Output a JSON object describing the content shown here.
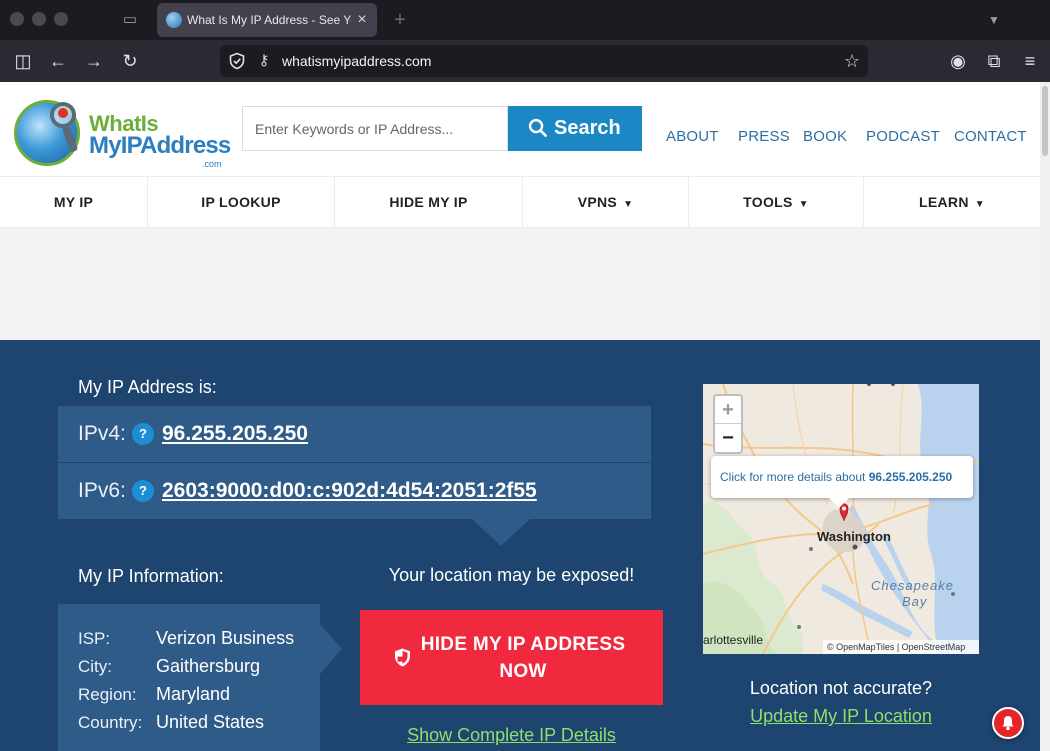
{
  "browser": {
    "tab_title": "What Is My IP Address - See Your Public Address",
    "tab_close": "×",
    "new_tab": "+",
    "url": "whatismyipaddress.com"
  },
  "site": {
    "logo": {
      "line1": "WhatIs",
      "line2": "MyIPAddress",
      "line3": ".com"
    },
    "search": {
      "placeholder": "Enter Keywords or IP Address...",
      "button": "Search"
    },
    "top_links": [
      "ABOUT",
      "PRESS",
      "BOOK",
      "PODCAST",
      "CONTACT"
    ],
    "nav": [
      {
        "label": "MY IP",
        "caret": ""
      },
      {
        "label": "IP LOOKUP",
        "caret": ""
      },
      {
        "label": "HIDE MY IP",
        "caret": ""
      },
      {
        "label": "VPNS",
        "caret": "▼"
      },
      {
        "label": "TOOLS",
        "caret": "▼"
      },
      {
        "label": "LEARN",
        "caret": "▼"
      }
    ]
  },
  "hero": {
    "ip_heading": "My IP Address is:",
    "ipv4": {
      "label": "IPv4:",
      "help": "?",
      "value": "96.255.205.250"
    },
    "ipv6": {
      "label": "IPv6:",
      "help": "?",
      "value": "2603:9000:d00:c:902d:4d54:2051:2f55"
    },
    "info_heading": "My IP Information:",
    "info": [
      {
        "label": "ISP:",
        "value": "Verizon Business"
      },
      {
        "label": "City:",
        "value": "Gaithersburg"
      },
      {
        "label": "Region:",
        "value": "Maryland"
      },
      {
        "label": "Country:",
        "value": "United States"
      }
    ],
    "exposed_text": "Your location may be exposed!",
    "hide_button_line1": "HIDE MY IP ADDRESS",
    "hide_button_line2": "NOW",
    "show_details": "Show Complete IP Details",
    "map": {
      "zoom_in": "+",
      "zoom_out": "−",
      "popup_prefix": "Click for more details about",
      "popup_ip": "96.255.205.250",
      "city_label": "Washington",
      "bay_label_1": "Chesapeake",
      "bay_label_2": "Bay",
      "town_label": "arlottesville",
      "attribution": "© OpenMapTiles | OpenStreetMap"
    },
    "location_question": "Location not accurate?",
    "update_location": "Update My IP Location"
  },
  "colors": {
    "hero_bg": "#1e4470",
    "row_bg": "#2e5b88",
    "accent_blue": "#1b87c4",
    "cta_red": "#f0293e",
    "link_green": "#8fe06b"
  }
}
